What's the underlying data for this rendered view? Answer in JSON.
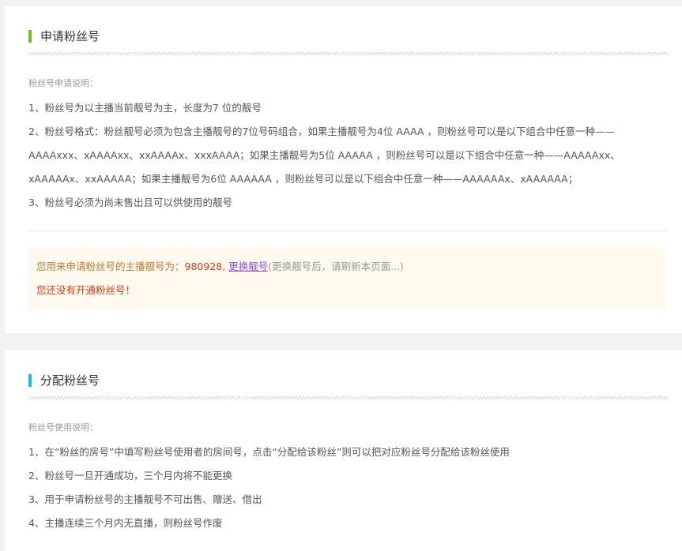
{
  "apply": {
    "title": "申请粉丝号",
    "bar_color": "#6fc21e",
    "note_label": "粉丝号申请说明：",
    "lines": [
      "1、粉丝号为以主播当前靓号为主，长度为7 位的靓号",
      "2、粉丝号格式：粉丝靓号必须为包含主播靓号的7位号码组合，如果主播靓号为4位 AAAA ，则粉丝号可以是以下组合中任意一种——",
      "AAAAxxx、xAAAAxx、xxAAAAx、xxxAAAA；如果主播靓号为5位 AAAAA ，则粉丝号可以是以下组合中任意一种——AAAAAxx、",
      "xAAAAAx、xxAAAAA；如果主播靓号为6位 AAAAAA ，则粉丝号可以是以下组合中任意一种——AAAAAAx、xAAAAAA；",
      "3、粉丝号必须为尚未售出且可以供使用的靓号"
    ],
    "tip": {
      "prefix": "您用来申请粉丝号的主播靓号为：",
      "number": "980928",
      "comma": ", ",
      "change_link": "更换靓号",
      "change_hint": "(更换靓号后，请刷新本页面...)",
      "status": "您还没有开通粉丝号！"
    }
  },
  "assign": {
    "title": "分配粉丝号",
    "bar_color": "#27b5e8",
    "note_label": "粉丝号使用说明：",
    "lines": [
      "1、在“粉丝的房号”中填写粉丝号使用者的房间号，点击“分配给该粉丝”则可以把对应粉丝号分配给该粉丝使用",
      "2、粉丝号一旦开通成功，三个月内将不能更换",
      "3、用于申请粉丝号的主播靓号不可出售、赠送、借出",
      "4、主播连续三个月内无直播，则粉丝号作废"
    ]
  }
}
